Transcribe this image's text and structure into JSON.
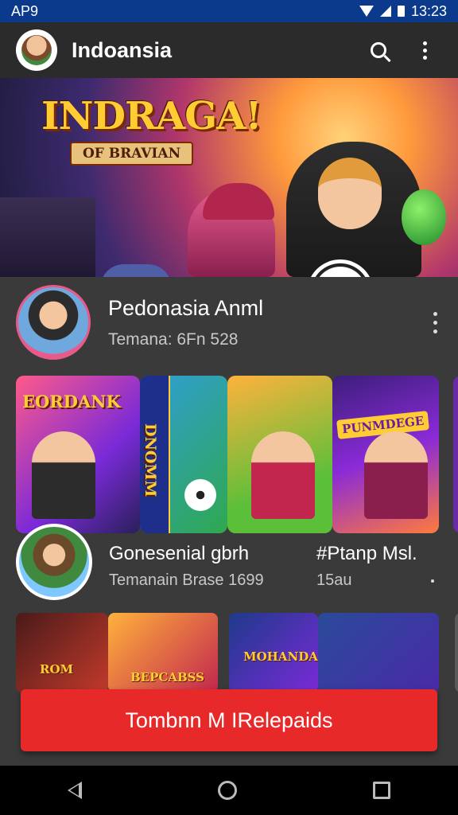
{
  "status_bar": {
    "left_text": "AP9",
    "time": "13:23",
    "icons": [
      "wifi-icon",
      "signal-icon",
      "battery-icon"
    ]
  },
  "app_bar": {
    "title": "Indoansia",
    "icons": [
      "search-icon",
      "more-vert-icon"
    ]
  },
  "hero": {
    "title": "INDRAGA!",
    "subtitle": "OF BRAVIAN"
  },
  "featured": {
    "title": "Pedonasia Anml",
    "subtitle": "Temana: 6Fn    528"
  },
  "cards": [
    {
      "logo": "EORDANK"
    },
    {
      "logo": "DNOMM"
    },
    {
      "logo": ""
    },
    {
      "logo": "PUNMDEGE"
    }
  ],
  "row2": {
    "title_1": "Gonesenial gbrh",
    "subtitle_1": "Temanain Brase 1699",
    "title_2": "#Ptanp Msl.",
    "subtitle_2": "15au"
  },
  "thumbs": [
    {
      "logo": "ROM"
    },
    {
      "logo": "BEPCABSS"
    },
    {
      "logo": "MOHANDA"
    },
    {
      "logo": ""
    }
  ],
  "cta": {
    "label": "Tombnn M IRelepaids"
  },
  "colors": {
    "status_bar": "#0b3a8c",
    "app_bar": "#2b2b2b",
    "background": "#3a3a3a",
    "cta": "#e8292a"
  }
}
